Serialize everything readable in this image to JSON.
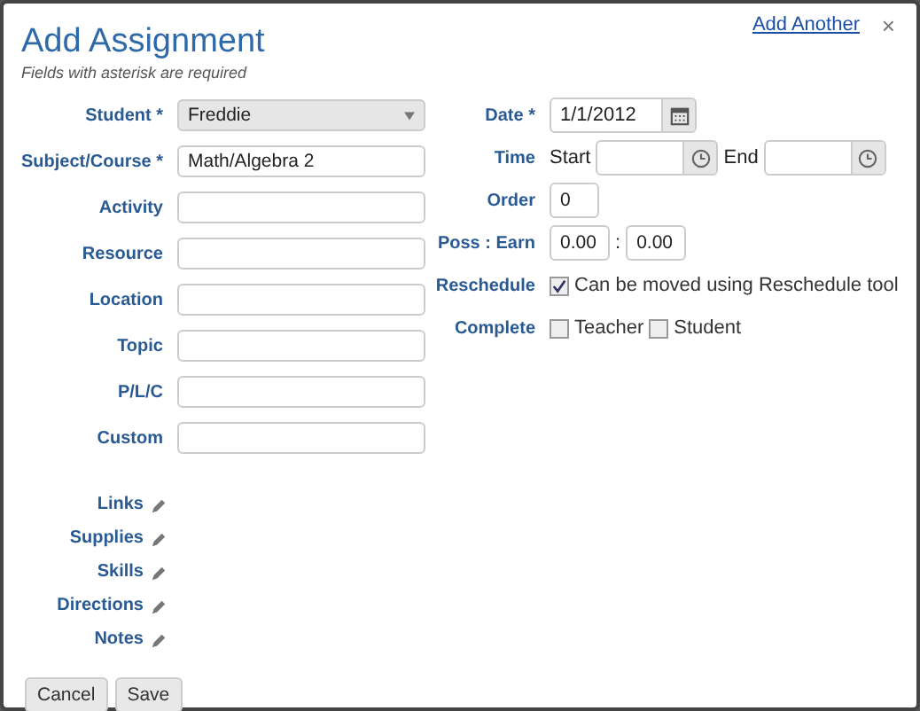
{
  "dialog": {
    "title": "Add Assignment",
    "subtitle": "Fields with asterisk are required",
    "add_another": "Add Another",
    "close": "×"
  },
  "left_fields": [
    {
      "label": "Student *",
      "kind": "select",
      "value": "Freddie"
    },
    {
      "label": "Subject/Course *",
      "kind": "text",
      "value": "Math/Algebra 2"
    },
    {
      "label": "Activity",
      "kind": "text"
    },
    {
      "label": "Resource",
      "kind": "text"
    },
    {
      "label": "Location",
      "kind": "text"
    },
    {
      "label": "Topic",
      "kind": "text"
    },
    {
      "label": "P/L/C",
      "kind": "text"
    },
    {
      "label": "Custom",
      "kind": "text"
    }
  ],
  "right_fields": [
    {
      "label": "Date *",
      "kind": "date",
      "value": "1/1/2012"
    },
    {
      "label": "Time",
      "kind": "time",
      "parts": [
        {
          "label": "Start"
        },
        {
          "label": "End"
        }
      ]
    },
    {
      "label": "Order",
      "kind": "small",
      "value": "0"
    },
    {
      "label": "Poss : Earn",
      "kind": "pair",
      "values": [
        "0.00",
        "0.00"
      ],
      "separator": ":"
    },
    {
      "label": "Reschedule",
      "kind": "checks",
      "options": [
        {
          "label": "Can be moved using Reschedule tool",
          "checked": true
        }
      ]
    },
    {
      "label": "Complete",
      "kind": "checks",
      "options": [
        {
          "label": "Teacher",
          "checked": false
        },
        {
          "label": "Student",
          "checked": false
        }
      ]
    }
  ],
  "links": [
    {
      "label": "Links"
    },
    {
      "label": "Supplies"
    },
    {
      "label": "Skills"
    },
    {
      "label": "Directions"
    },
    {
      "label": "Notes"
    }
  ],
  "buttons": [
    "Cancel",
    "Save"
  ]
}
